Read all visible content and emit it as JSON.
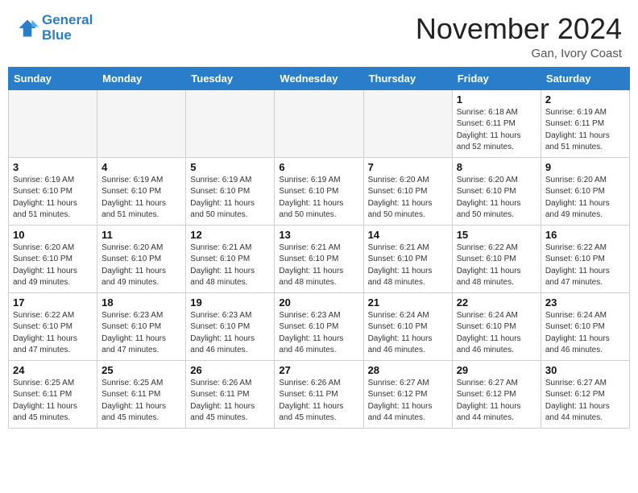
{
  "header": {
    "logo_line1": "General",
    "logo_line2": "Blue",
    "month_title": "November 2024",
    "location": "Gan, Ivory Coast"
  },
  "weekdays": [
    "Sunday",
    "Monday",
    "Tuesday",
    "Wednesday",
    "Thursday",
    "Friday",
    "Saturday"
  ],
  "weeks": [
    [
      {
        "day": "",
        "detail": "",
        "empty": true
      },
      {
        "day": "",
        "detail": "",
        "empty": true
      },
      {
        "day": "",
        "detail": "",
        "empty": true
      },
      {
        "day": "",
        "detail": "",
        "empty": true
      },
      {
        "day": "",
        "detail": "",
        "empty": true
      },
      {
        "day": "1",
        "detail": "Sunrise: 6:18 AM\nSunset: 6:11 PM\nDaylight: 11 hours\nand 52 minutes.",
        "empty": false
      },
      {
        "day": "2",
        "detail": "Sunrise: 6:19 AM\nSunset: 6:11 PM\nDaylight: 11 hours\nand 51 minutes.",
        "empty": false
      }
    ],
    [
      {
        "day": "3",
        "detail": "Sunrise: 6:19 AM\nSunset: 6:10 PM\nDaylight: 11 hours\nand 51 minutes.",
        "empty": false
      },
      {
        "day": "4",
        "detail": "Sunrise: 6:19 AM\nSunset: 6:10 PM\nDaylight: 11 hours\nand 51 minutes.",
        "empty": false
      },
      {
        "day": "5",
        "detail": "Sunrise: 6:19 AM\nSunset: 6:10 PM\nDaylight: 11 hours\nand 50 minutes.",
        "empty": false
      },
      {
        "day": "6",
        "detail": "Sunrise: 6:19 AM\nSunset: 6:10 PM\nDaylight: 11 hours\nand 50 minutes.",
        "empty": false
      },
      {
        "day": "7",
        "detail": "Sunrise: 6:20 AM\nSunset: 6:10 PM\nDaylight: 11 hours\nand 50 minutes.",
        "empty": false
      },
      {
        "day": "8",
        "detail": "Sunrise: 6:20 AM\nSunset: 6:10 PM\nDaylight: 11 hours\nand 50 minutes.",
        "empty": false
      },
      {
        "day": "9",
        "detail": "Sunrise: 6:20 AM\nSunset: 6:10 PM\nDaylight: 11 hours\nand 49 minutes.",
        "empty": false
      }
    ],
    [
      {
        "day": "10",
        "detail": "Sunrise: 6:20 AM\nSunset: 6:10 PM\nDaylight: 11 hours\nand 49 minutes.",
        "empty": false
      },
      {
        "day": "11",
        "detail": "Sunrise: 6:20 AM\nSunset: 6:10 PM\nDaylight: 11 hours\nand 49 minutes.",
        "empty": false
      },
      {
        "day": "12",
        "detail": "Sunrise: 6:21 AM\nSunset: 6:10 PM\nDaylight: 11 hours\nand 48 minutes.",
        "empty": false
      },
      {
        "day": "13",
        "detail": "Sunrise: 6:21 AM\nSunset: 6:10 PM\nDaylight: 11 hours\nand 48 minutes.",
        "empty": false
      },
      {
        "day": "14",
        "detail": "Sunrise: 6:21 AM\nSunset: 6:10 PM\nDaylight: 11 hours\nand 48 minutes.",
        "empty": false
      },
      {
        "day": "15",
        "detail": "Sunrise: 6:22 AM\nSunset: 6:10 PM\nDaylight: 11 hours\nand 48 minutes.",
        "empty": false
      },
      {
        "day": "16",
        "detail": "Sunrise: 6:22 AM\nSunset: 6:10 PM\nDaylight: 11 hours\nand 47 minutes.",
        "empty": false
      }
    ],
    [
      {
        "day": "17",
        "detail": "Sunrise: 6:22 AM\nSunset: 6:10 PM\nDaylight: 11 hours\nand 47 minutes.",
        "empty": false
      },
      {
        "day": "18",
        "detail": "Sunrise: 6:23 AM\nSunset: 6:10 PM\nDaylight: 11 hours\nand 47 minutes.",
        "empty": false
      },
      {
        "day": "19",
        "detail": "Sunrise: 6:23 AM\nSunset: 6:10 PM\nDaylight: 11 hours\nand 46 minutes.",
        "empty": false
      },
      {
        "day": "20",
        "detail": "Sunrise: 6:23 AM\nSunset: 6:10 PM\nDaylight: 11 hours\nand 46 minutes.",
        "empty": false
      },
      {
        "day": "21",
        "detail": "Sunrise: 6:24 AM\nSunset: 6:10 PM\nDaylight: 11 hours\nand 46 minutes.",
        "empty": false
      },
      {
        "day": "22",
        "detail": "Sunrise: 6:24 AM\nSunset: 6:10 PM\nDaylight: 11 hours\nand 46 minutes.",
        "empty": false
      },
      {
        "day": "23",
        "detail": "Sunrise: 6:24 AM\nSunset: 6:10 PM\nDaylight: 11 hours\nand 46 minutes.",
        "empty": false
      }
    ],
    [
      {
        "day": "24",
        "detail": "Sunrise: 6:25 AM\nSunset: 6:11 PM\nDaylight: 11 hours\nand 45 minutes.",
        "empty": false
      },
      {
        "day": "25",
        "detail": "Sunrise: 6:25 AM\nSunset: 6:11 PM\nDaylight: 11 hours\nand 45 minutes.",
        "empty": false
      },
      {
        "day": "26",
        "detail": "Sunrise: 6:26 AM\nSunset: 6:11 PM\nDaylight: 11 hours\nand 45 minutes.",
        "empty": false
      },
      {
        "day": "27",
        "detail": "Sunrise: 6:26 AM\nSunset: 6:11 PM\nDaylight: 11 hours\nand 45 minutes.",
        "empty": false
      },
      {
        "day": "28",
        "detail": "Sunrise: 6:27 AM\nSunset: 6:12 PM\nDaylight: 11 hours\nand 44 minutes.",
        "empty": false
      },
      {
        "day": "29",
        "detail": "Sunrise: 6:27 AM\nSunset: 6:12 PM\nDaylight: 11 hours\nand 44 minutes.",
        "empty": false
      },
      {
        "day": "30",
        "detail": "Sunrise: 6:27 AM\nSunset: 6:12 PM\nDaylight: 11 hours\nand 44 minutes.",
        "empty": false
      }
    ]
  ]
}
